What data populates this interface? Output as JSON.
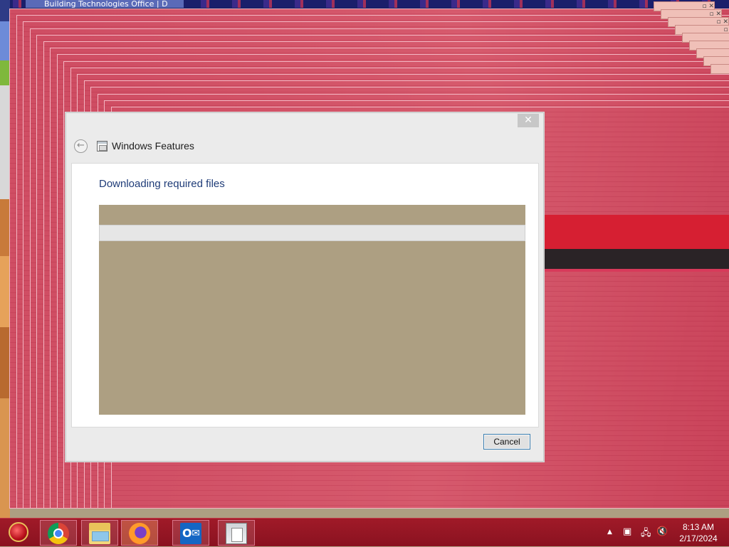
{
  "background_window": {
    "tab_title": "Building Technologies Office | D"
  },
  "dialog": {
    "window_title": "Windows Features",
    "heading": "Downloading required files",
    "progress": 0,
    "cancel_label": "Cancel",
    "close_glyph": "✕",
    "back_glyph": "←"
  },
  "taskbar": {
    "pinned": [
      {
        "name": "chrome-icon"
      },
      {
        "name": "file-explorer-icon"
      },
      {
        "name": "firefox-icon"
      },
      {
        "name": "outlook-icon",
        "glyph": "O"
      },
      {
        "name": "windows-features-icon"
      }
    ],
    "tray": {
      "overflow_glyph": "▲",
      "clock_time": "8:13 AM",
      "clock_date": "2/17/2024"
    }
  },
  "colors": {
    "accent_heading": "#1f3c78",
    "taskbar": "#8a1220",
    "desktop": "#ad9f82",
    "dialog_trail": "#cf4d63"
  }
}
